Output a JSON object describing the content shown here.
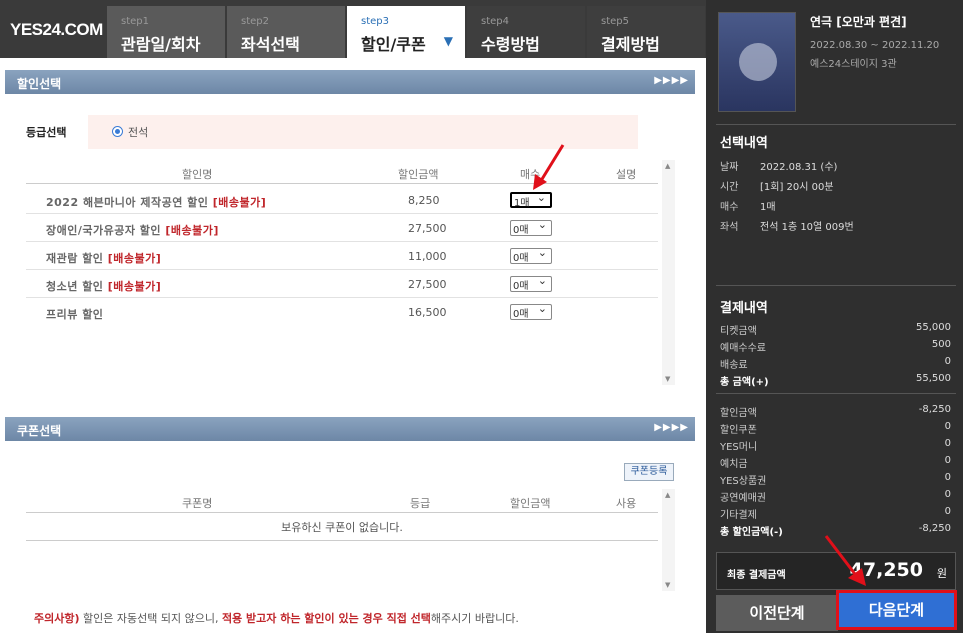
{
  "logo": "YES24.COM",
  "steps": [
    {
      "num": "step1",
      "label": "관람일/회차"
    },
    {
      "num": "step2",
      "label": "좌석선택"
    },
    {
      "num": "step3",
      "label": "할인/쿠폰"
    },
    {
      "num": "step4",
      "label": "수령방법"
    },
    {
      "num": "step5",
      "label": "결제방법"
    }
  ],
  "discount": {
    "section_title": "할인선택",
    "grade_label": "등급선택",
    "grade_value": "전석",
    "headers": {
      "name": "할인명",
      "amount": "할인금액",
      "qty": "매수",
      "desc": "설명"
    },
    "rows": [
      {
        "name": "2022 해븐마니아 제작공연 할인",
        "tag": "[배송불가]",
        "amount": "8,250",
        "qty": "1매"
      },
      {
        "name": "장애인/국가유공자 할인",
        "tag": "[배송불가]",
        "amount": "27,500",
        "qty": "0매"
      },
      {
        "name": "재관람 할인",
        "tag": "[배송불가]",
        "amount": "11,000",
        "qty": "0매"
      },
      {
        "name": "청소년 할인",
        "tag": "[배송불가]",
        "amount": "27,500",
        "qty": "0매"
      },
      {
        "name": "프리뷰 할인",
        "tag": "",
        "amount": "16,500",
        "qty": "0매"
      }
    ]
  },
  "coupon": {
    "section_title": "쿠폰선택",
    "register_label": "쿠폰등록",
    "headers": {
      "name": "쿠폰명",
      "grade": "등급",
      "amount": "할인금액",
      "use": "사용"
    },
    "empty": "보유하신 쿠폰이 없습니다."
  },
  "notice": {
    "lead": "주의사항)",
    "text1": " 할인은 자동선택 되지 않으니, ",
    "emph": "적용 받고자 하는 할인이 있는 경우 직접 선택",
    "text2": "해주시기 바랍니다."
  },
  "show": {
    "title": "연극 [오만과 편견]",
    "dates": "2022.08.30 ~ 2022.11.20",
    "venue": "예스24스테이지 3관"
  },
  "selection": {
    "title": "선택내역",
    "items": [
      {
        "k": "날짜",
        "v": "2022.08.31 (수)"
      },
      {
        "k": "시간",
        "v": "[1회] 20시 00분"
      },
      {
        "k": "매수",
        "v": "1매"
      },
      {
        "k": "좌석",
        "v": "전석 1층 10열 009번"
      }
    ]
  },
  "payment": {
    "title": "결제내역",
    "items": [
      {
        "k": "티켓금액",
        "v": "55,000",
        "b": false
      },
      {
        "k": "예매수수료",
        "v": "500",
        "b": false
      },
      {
        "k": "배송료",
        "v": "0",
        "b": false
      },
      {
        "k": "총 금액(+)",
        "v": "55,500",
        "b": true
      }
    ],
    "discounts": [
      {
        "k": "할인금액",
        "v": "-8,250",
        "b": false
      },
      {
        "k": "할인쿠폰",
        "v": "0",
        "b": false
      },
      {
        "k": "YES머니",
        "v": "0",
        "b": false
      },
      {
        "k": "예치금",
        "v": "0",
        "b": false
      },
      {
        "k": "YES상품권",
        "v": "0",
        "b": false
      },
      {
        "k": "공연예매권",
        "v": "0",
        "b": false
      },
      {
        "k": "기타결제",
        "v": "0",
        "b": false
      },
      {
        "k": "총 할인금액(-)",
        "v": "-8,250",
        "b": true
      }
    ],
    "final_label": "최종 결제금액",
    "final_value": "47,250",
    "final_unit": "원"
  },
  "buttons": {
    "prev": "이전단계",
    "next": "다음단계"
  }
}
